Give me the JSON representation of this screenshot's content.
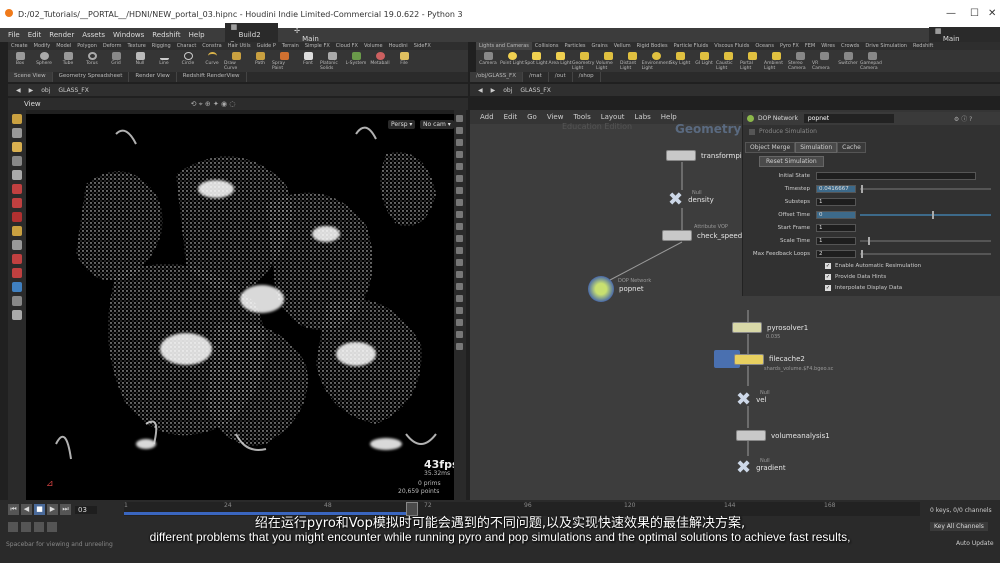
{
  "window": {
    "title": "D:/02_Tutorials/__PORTAL__/HDNI/NEW_portal_03.hipnc - Houdini Indie Limited-Commercial 19.0.622 - Python 3",
    "minimize": "—",
    "maximize": "☐",
    "close": "✕"
  },
  "menu": [
    "File",
    "Edit",
    "Render",
    "Assets",
    "Windows",
    "Redshift",
    "Help"
  ],
  "desktop_left": "Build2",
  "desktop_right": "Main",
  "shelf_tabs_left": [
    "Create",
    "Modify",
    "Model",
    "Polygon",
    "Deform",
    "Texture",
    "Rigging",
    "Charact",
    "Constra",
    "Hair Utils",
    "Guide P",
    "Terrain",
    "Simple FX",
    "Cloud FX",
    "Volume",
    "Houdini",
    "SideFX"
  ],
  "shelf_tabs_right": [
    "Lights and Cameras",
    "Collisions",
    "Particles",
    "Grains",
    "Vellum",
    "Rigid Bodies",
    "Particle Fluids",
    "Viscous Fluids",
    "Oceans",
    "Pyro FX",
    "FEM",
    "Wires",
    "Crowds",
    "Drive Simulation",
    "Redshift"
  ],
  "shelf_tools_left": [
    "Box",
    "Sphere",
    "Tube",
    "Torus",
    "Grid",
    "Null",
    "Line",
    "Circle",
    "Curve",
    "Draw Curve",
    "Path",
    "Spray Paint",
    "Font",
    "Platonic Solids",
    "L-System",
    "Metaball",
    "File"
  ],
  "shelf_tools_right": [
    "Camera",
    "Point Light",
    "Spot Light",
    "Area Light",
    "Geometry Light",
    "Volume Light",
    "Distant Light",
    "Environment Light",
    "Sky Light",
    "GI Light",
    "Caustic Light",
    "Portal Light",
    "Ambient Light",
    "Stereo Camera",
    "VR Camera",
    "Switcher",
    "Gamepad Camera"
  ],
  "pane_tabs_left": [
    "Scene View",
    "Geometry Spreadsheet",
    "Render View",
    "Redshift RenderView"
  ],
  "path_left": [
    "obj",
    "GLASS_FX"
  ],
  "path_right_tabs": [
    "/obj/GLASS_FX",
    "/mat",
    "/out",
    "/shop"
  ],
  "path_right": [
    "obj",
    "GLASS_FX"
  ],
  "viewport": {
    "label": "View",
    "persp": "Persp ▾",
    "cam": "No cam ▾",
    "fps": "43fps",
    "fps_sub": "35.32ms",
    "prims": "0  prims",
    "points": "20,659  points"
  },
  "net_menu": [
    "Add",
    "Edit",
    "Go",
    "View",
    "Tools",
    "Layout",
    "Labs",
    "Help"
  ],
  "net_watermark": "Education Edition",
  "net_title": "Geometry",
  "nodes": [
    {
      "name": "transformpieces",
      "sub": ""
    },
    {
      "name": "density",
      "sub": "Null"
    },
    {
      "name": "check_speed",
      "sub": "Attribute VOP"
    },
    {
      "name": "popnet",
      "sub": "DOP Network"
    },
    {
      "name": "pyrosolver1",
      "sub": "0.035"
    },
    {
      "name": "filecache2",
      "sub": "shards_volume.$F4.bgeo.sc"
    },
    {
      "name": "vel",
      "sub": "Null"
    },
    {
      "name": "volumeanalysis1",
      "sub": ""
    },
    {
      "name": "gradient",
      "sub": "Null"
    }
  ],
  "params": {
    "type": "DOP Network",
    "name": "popnet",
    "header_note": "Produce Simulation",
    "tabs": [
      "Object Merge",
      "Simulation",
      "Cache"
    ],
    "reset_btn": "Reset Simulation",
    "rows": [
      {
        "label": "Initial State",
        "value": ""
      },
      {
        "label": "Timestep",
        "value": "0.0416667"
      },
      {
        "label": "Substeps",
        "value": "1"
      },
      {
        "label": "Offset Time",
        "value": "0"
      },
      {
        "label": "Start Frame",
        "value": "1"
      },
      {
        "label": "Scale Time",
        "value": "1"
      },
      {
        "label": "Max Feedback Loops",
        "value": "2"
      }
    ],
    "checks": [
      "Enable Automatic Resimulation",
      "Provide Data Hints",
      "Interpolate Display Data"
    ]
  },
  "timeline": {
    "frame": "03",
    "ticks": [
      "1",
      "24",
      "48",
      "72",
      "96",
      "120",
      "144",
      "168"
    ],
    "keys_info": "0 keys, 0/0 channels",
    "key_all": "Key All Channels",
    "auto_update": "Auto Update",
    "status": "Spacebar for viewing and unreeling"
  },
  "subtitle_cn": "绍在运行pyro和Vop模拟时可能会遇到的不同问题,以及实现快速效果的最佳解决方案,",
  "subtitle_en": "different problems that you might encounter while running pyro and pop simulations and the optimal solutions to achieve fast results,"
}
